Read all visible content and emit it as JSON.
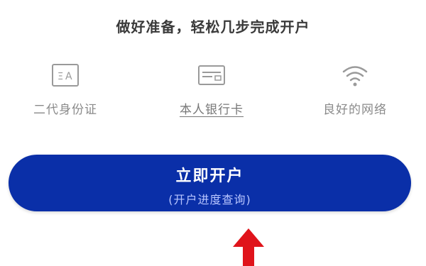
{
  "header": {
    "title": "做好准备，轻松几步完成开户"
  },
  "requirements": [
    {
      "label": "二代身份证",
      "icon": "id-card-icon"
    },
    {
      "label": "本人银行卡",
      "icon": "bank-card-icon"
    },
    {
      "label": "良好的网络",
      "icon": "wifi-icon"
    }
  ],
  "cta": {
    "label": "立即开户",
    "sublabel": "(开户进度查询)"
  },
  "colors": {
    "button": "#0a2fa8",
    "arrow": "#e0141b",
    "icon": "#9a9a9a"
  }
}
